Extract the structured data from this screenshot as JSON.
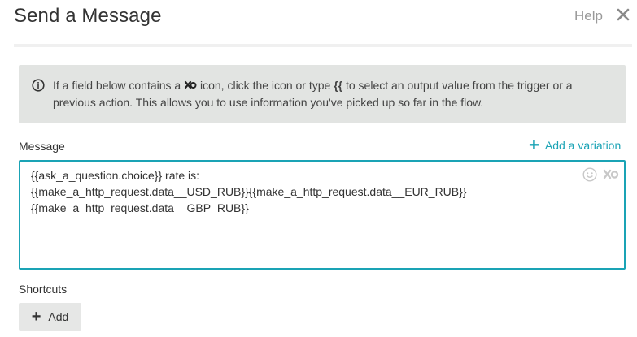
{
  "header": {
    "title": "Send a Message",
    "help_label": "Help",
    "close_icon": "close-icon"
  },
  "info_banner": {
    "icon": "info-icon",
    "text_before_icon": "If a field below contains a ",
    "dynamic_icon": "dynamic-content-icon",
    "text_after_icon": " icon, click the icon or type ",
    "shortcut": "{{",
    "text_end": " to select an output value from the trigger or a previous action. This allows you to use information you've picked up so far in the flow."
  },
  "message_field": {
    "label": "Message",
    "add_variation_label": "Add a variation",
    "value": "{{ask_a_question.choice}} rate is:\n{{make_a_http_request.data__USD_RUB}}{{make_a_http_request.data__EUR_RUB}}\n{{make_a_http_request.data__GBP_RUB}}",
    "emoji_icon": "emoji-icon",
    "dynamic_icon": "dynamic-content-icon"
  },
  "shortcuts": {
    "label": "Shortcuts",
    "add_label": "Add"
  },
  "colors": {
    "accent": "#1aa3b5",
    "info_background": "#e2e4e2",
    "button_background": "#e6e7e6",
    "muted_text": "#9a9a9a"
  }
}
